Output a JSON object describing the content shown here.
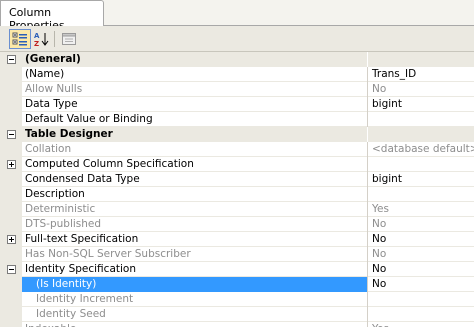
{
  "tab": {
    "title": "Column Properties"
  },
  "toolbar": {
    "categorized_label": "categorized-view",
    "alpha_label": "alphabetical-sort",
    "pages_label": "property-pages"
  },
  "rows": [
    {
      "type": "category",
      "toggle": "minus",
      "name": "(General)",
      "value": ""
    },
    {
      "type": "prop",
      "name": "(Name)",
      "value": "Trans_ID"
    },
    {
      "type": "prop",
      "dim": true,
      "name": "Allow Nulls",
      "value": "No"
    },
    {
      "type": "prop",
      "name": "Data Type",
      "value": "bigint"
    },
    {
      "type": "prop",
      "name": "Default Value or Binding",
      "value": ""
    },
    {
      "type": "category",
      "toggle": "minus",
      "name": "Table Designer",
      "value": ""
    },
    {
      "type": "prop",
      "dim": true,
      "name": "Collation",
      "value": "<database default>"
    },
    {
      "type": "prop",
      "toggle": "plus",
      "name": "Computed Column Specification",
      "value": ""
    },
    {
      "type": "prop",
      "name": "Condensed Data Type",
      "value": "bigint"
    },
    {
      "type": "prop",
      "name": "Description",
      "value": ""
    },
    {
      "type": "prop",
      "dim": true,
      "name": "Deterministic",
      "value": "Yes"
    },
    {
      "type": "prop",
      "dim": true,
      "name": "DTS-published",
      "value": "No"
    },
    {
      "type": "prop",
      "toggle": "plus",
      "name": "Full-text Specification",
      "value": "No"
    },
    {
      "type": "prop",
      "dim": true,
      "name": "Has Non-SQL Server Subscriber",
      "value": "No"
    },
    {
      "type": "prop",
      "toggle": "minus",
      "name": "Identity Specification",
      "value": "No"
    },
    {
      "type": "child",
      "selected": true,
      "name": "(Is Identity)",
      "value": "No"
    },
    {
      "type": "child",
      "dim": true,
      "name": "Identity Increment",
      "value": ""
    },
    {
      "type": "child",
      "dim": true,
      "name": "Identity Seed",
      "value": ""
    },
    {
      "type": "prop",
      "dim": true,
      "name": "Indexable",
      "value": "Yes"
    }
  ]
}
